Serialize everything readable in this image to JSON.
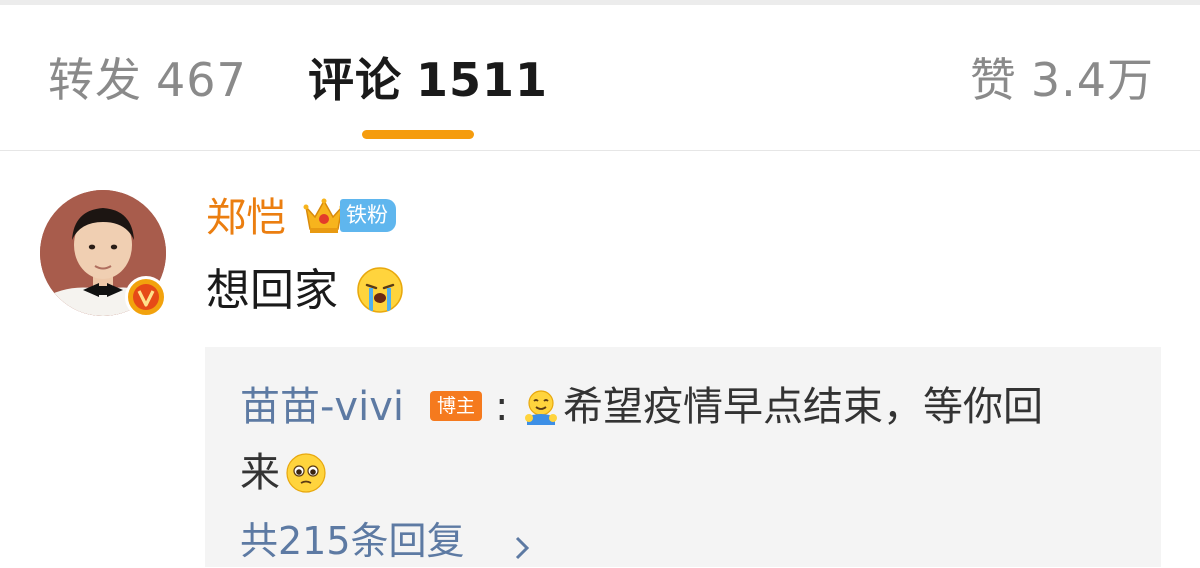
{
  "tabs": {
    "repost": {
      "label": "转发",
      "count": "467"
    },
    "comments": {
      "label": "评论",
      "count": "1511"
    },
    "likes": {
      "label": "赞",
      "count": "3.4万"
    }
  },
  "comment": {
    "username": "郑恺",
    "fan_badge": "铁粉",
    "text": "想回家",
    "reply": {
      "username": "苗苗-vivi",
      "author_badge": "博主",
      "colon": ":",
      "text_line1": "希望疫情早点结束，等你回",
      "text_line2": "来"
    },
    "more_replies": "共215条回复"
  },
  "colors": {
    "active_indicator": "#f59c0e",
    "username": "#eb7e10",
    "link": "#5d7aa3",
    "fan_badge": "#5fb6ee",
    "author_badge": "#f57a1e"
  },
  "icons": [
    "crown-icon",
    "cry-emoji-icon",
    "hug-emoji-icon",
    "pleading-emoji-icon",
    "verified-badge-icon",
    "chevron-right-icon"
  ]
}
